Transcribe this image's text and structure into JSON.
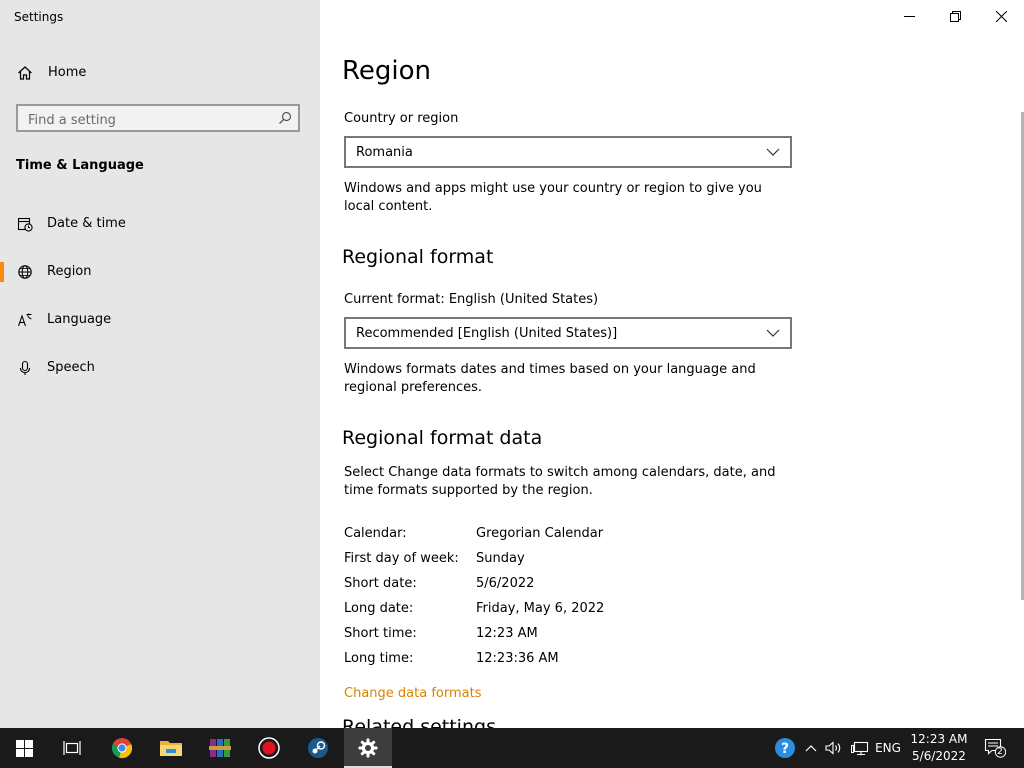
{
  "app": {
    "title": "Settings"
  },
  "sidebar": {
    "home_label": "Home",
    "search_placeholder": "Find a setting",
    "section_title": "Time & Language",
    "items": [
      {
        "label": "Date & time",
        "icon": "calendar-clock-icon"
      },
      {
        "label": "Region",
        "icon": "globe-icon",
        "active": true
      },
      {
        "label": "Language",
        "icon": "language-icon"
      },
      {
        "label": "Speech",
        "icon": "microphone-icon"
      }
    ]
  },
  "main": {
    "title": "Region",
    "country": {
      "label": "Country or region",
      "value": "Romania",
      "description": "Windows and apps might use your country or region to give you local content."
    },
    "regional_format": {
      "heading": "Regional format",
      "current_label": "Current format: English (United States)",
      "value": "Recommended [English (United States)]",
      "description": "Windows formats dates and times based on your language and regional preferences."
    },
    "regional_format_data": {
      "heading": "Regional format data",
      "description": "Select Change data formats to switch among calendars, date, and time formats supported by the region.",
      "rows": [
        {
          "key": "Calendar:",
          "value": "Gregorian Calendar"
        },
        {
          "key": "First day of week:",
          "value": "Sunday"
        },
        {
          "key": "Short date:",
          "value": "5/6/2022"
        },
        {
          "key": "Long date:",
          "value": "Friday, May 6, 2022"
        },
        {
          "key": "Short time:",
          "value": "12:23 AM"
        },
        {
          "key": "Long time:",
          "value": "12:23:36 AM"
        }
      ],
      "change_link": "Change data formats"
    },
    "related_heading": "Related settings"
  },
  "taskbar": {
    "apps": [
      "start-icon",
      "task-view-icon",
      "chrome-icon",
      "file-explorer-icon",
      "winrar-icon",
      "record-icon",
      "steam-icon",
      "settings-icon"
    ],
    "language": "ENG",
    "time": "12:23 AM",
    "date": "5/6/2022",
    "notification_count": "2"
  },
  "colors": {
    "accent": "#ff8c00",
    "link": "#d78300",
    "sidebar_bg": "#e6e6e6",
    "taskbar_bg": "#1a1a1a"
  }
}
